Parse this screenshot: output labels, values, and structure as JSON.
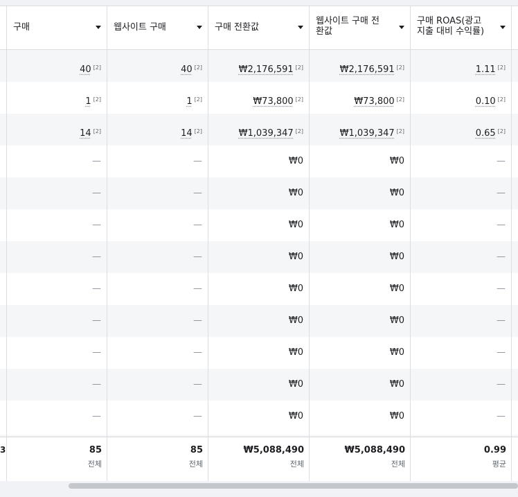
{
  "columns": [
    {
      "label": "구매"
    },
    {
      "label": "웹사이트 구매"
    },
    {
      "label": "구매 전환값"
    },
    {
      "label": "웹사이트 구매 전\n환값"
    },
    {
      "label": "구매 ROAS(광고\n지출 대비 수익률)"
    }
  ],
  "rows": [
    {
      "cells": [
        "40",
        "40",
        "₩2,176,591",
        "₩2,176,591",
        "1.11"
      ],
      "footnote": "[2]"
    },
    {
      "cells": [
        "1",
        "1",
        "₩73,800",
        "₩73,800",
        "0.10"
      ],
      "footnote": "[2]"
    },
    {
      "cells": [
        "14",
        "14",
        "₩1,039,347",
        "₩1,039,347",
        "0.65"
      ],
      "footnote": "[2]"
    },
    {
      "cells": [
        "—",
        "—",
        "₩0",
        "₩0",
        "—"
      ]
    },
    {
      "cells": [
        "—",
        "—",
        "₩0",
        "₩0",
        "—"
      ]
    },
    {
      "cells": [
        "—",
        "—",
        "₩0",
        "₩0",
        "—"
      ]
    },
    {
      "cells": [
        "—",
        "—",
        "₩0",
        "₩0",
        "—"
      ]
    },
    {
      "cells": [
        "—",
        "—",
        "₩0",
        "₩0",
        "—"
      ]
    },
    {
      "cells": [
        "—",
        "—",
        "₩0",
        "₩0",
        "—"
      ]
    },
    {
      "cells": [
        "—",
        "—",
        "₩0",
        "₩0",
        "—"
      ]
    },
    {
      "cells": [
        "—",
        "—",
        "₩0",
        "₩0",
        "—"
      ]
    },
    {
      "cells": [
        "—",
        "—",
        "₩0",
        "₩0",
        "—"
      ]
    }
  ],
  "summary": {
    "left_fragment": "3",
    "totals": [
      {
        "value": "85",
        "label": "전체"
      },
      {
        "value": "85",
        "label": "전체"
      },
      {
        "value": "₩5,088,490",
        "label": "전체"
      },
      {
        "value": "₩5,088,490",
        "label": "전체"
      },
      {
        "value": "0.99",
        "label": "평균"
      }
    ]
  },
  "colors": {
    "border": "#dadde1",
    "alt_row": "#f5f6f7",
    "muted": "#606770",
    "scrollbar": "#c4c7cc"
  }
}
